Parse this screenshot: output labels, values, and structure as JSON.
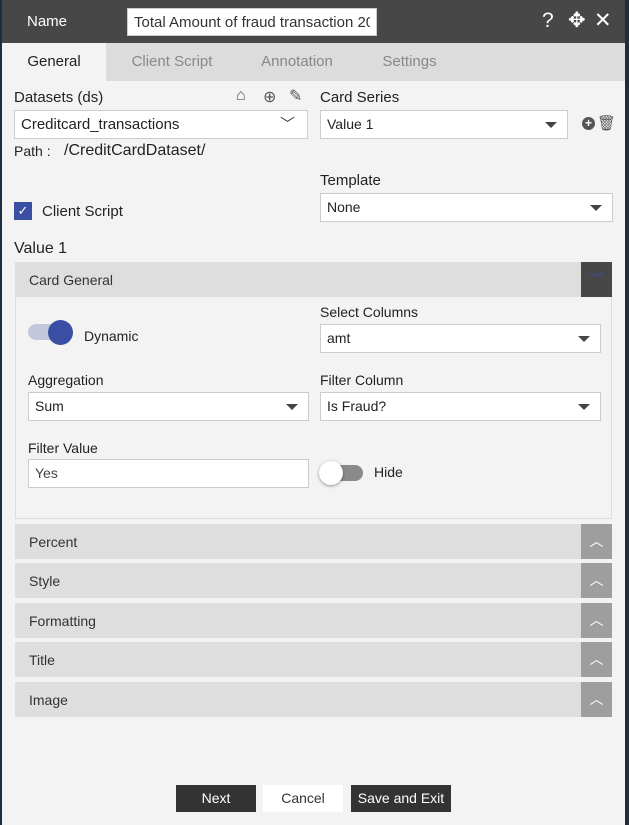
{
  "header": {
    "name_label": "Name",
    "name_value": "Total Amount of fraud transaction 20("
  },
  "tabs": [
    {
      "label": "General"
    },
    {
      "label": "Client Script"
    },
    {
      "label": "Annotation"
    },
    {
      "label": "Settings"
    }
  ],
  "datasets": {
    "label": "Datasets (ds)",
    "value": "Creditcard_transactions",
    "path_label": "Path :",
    "path_value": "/CreditCardDataset/"
  },
  "card_series": {
    "label": "Card Series",
    "value": "Value 1"
  },
  "client_script": {
    "label": "Client Script",
    "checked": true
  },
  "template": {
    "label": "Template",
    "value": "None"
  },
  "section_title": "Value 1",
  "card_general": {
    "title": "Card General",
    "dynamic_label": "Dynamic",
    "dynamic_on": true,
    "select_columns_label": "Select Columns",
    "select_columns_value": "amt",
    "aggregation_label": "Aggregation",
    "aggregation_value": "Sum",
    "filter_column_label": "Filter Column",
    "filter_column_value": "Is Fraud?",
    "filter_value_label": "Filter Value",
    "filter_value": "Yes",
    "hide_label": "Hide",
    "hide_on": false
  },
  "accordions": [
    {
      "title": "Percent"
    },
    {
      "title": "Style"
    },
    {
      "title": "Formatting"
    },
    {
      "title": "Title"
    },
    {
      "title": "Image"
    }
  ],
  "footer": {
    "next": "Next",
    "cancel": "Cancel",
    "save_exit": "Save and Exit"
  },
  "colors": {
    "accent": "#3a4fa3",
    "header": "#474747"
  }
}
